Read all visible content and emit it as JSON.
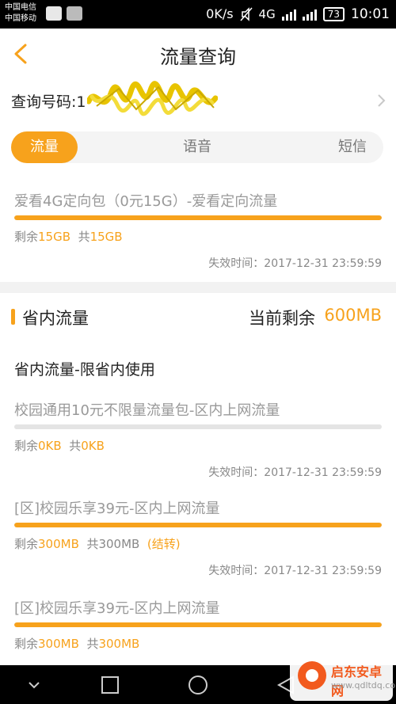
{
  "status_bar": {
    "carrier_1": "中国电信",
    "carrier_2": "中国移动",
    "speed": "0K/s",
    "network": "4G",
    "battery": "73",
    "time": "10:01"
  },
  "header": {
    "title": "流量查询"
  },
  "query": {
    "label": "查询号码:1"
  },
  "tabs": [
    {
      "label": "流量",
      "active": true
    },
    {
      "label": "语音",
      "active": false
    },
    {
      "label": "短信",
      "active": false
    }
  ],
  "package_main": {
    "name": "爱看4G定向包（0元15G）-爱看定向流量",
    "remain_prefix": "剩余",
    "remain_value": "15GB",
    "total_prefix": "共",
    "total_value": "15GB",
    "expire": "失效时间：2017-12-31 23:59:59",
    "usage_fraction": 1.0
  },
  "province_section": {
    "title": "省内流量",
    "current_remain_label": "当前剩余",
    "current_remain_value": "600MB",
    "subtitle": "省内流量-限省内使用",
    "packages": [
      {
        "name": "校园通用10元不限量流量包-区内上网流量",
        "remain_prefix": "剩余",
        "remain_value": "0KB",
        "total_prefix": "共",
        "total_value": "0KB",
        "note": "",
        "expire": "失效时间：2017-12-31 23:59:59",
        "usage_fraction": 0.0
      },
      {
        "name": "[区]校园乐享39元-区内上网流量",
        "remain_prefix": "剩余",
        "remain_value": "300MB",
        "total_prefix": "共",
        "total_value": "300MB",
        "note": "(结转)",
        "expire": "失效时间：2017-12-31 23:59:59",
        "usage_fraction": 1.0
      },
      {
        "name": "[区]校园乐享39元-区内上网流量",
        "remain_prefix": "剩余",
        "remain_value": "300MB",
        "total_prefix": "共",
        "total_value": "300MB",
        "note": "",
        "expire": "",
        "usage_fraction": 1.0
      }
    ]
  },
  "watermark": {
    "title": "启东安卓网",
    "url": "www.qdltdq.com"
  },
  "colors": {
    "accent": "#f7a21c",
    "track": "#e4e4e4"
  }
}
